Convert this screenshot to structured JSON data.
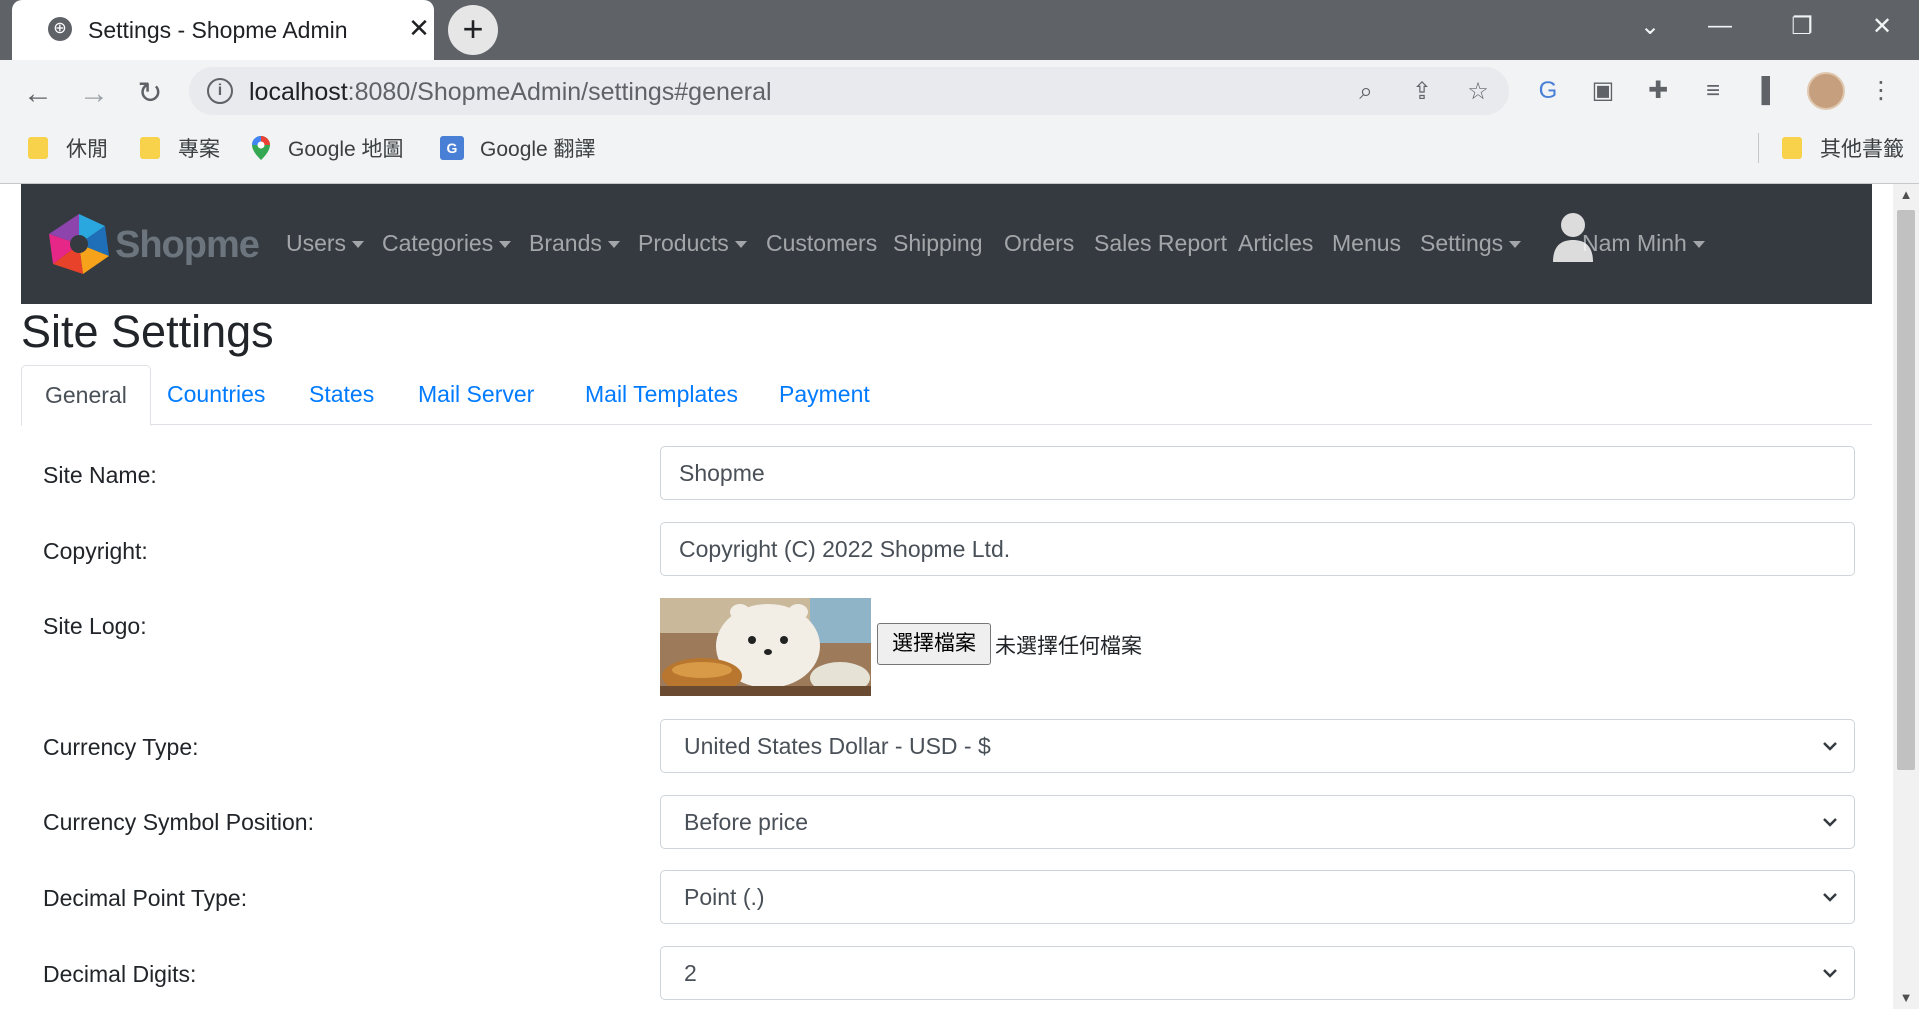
{
  "browser": {
    "tab_title": "Settings - Shopme Admin",
    "url_host": "localhost",
    "url_path": ":8080/ShopmeAdmin/settings#general",
    "bookmarks": [
      {
        "label": "休閒",
        "icon": "folder-icon"
      },
      {
        "label": "專案",
        "icon": "folder-icon"
      },
      {
        "label": "Google 地圖",
        "icon": "google-maps-icon"
      },
      {
        "label": "Google 翻譯",
        "icon": "google-translate-icon"
      }
    ],
    "other_bookmarks": "其他書籤"
  },
  "nav": {
    "brand": "Shopme",
    "items": [
      {
        "label": "Users",
        "dropdown": true
      },
      {
        "label": "Categories",
        "dropdown": true
      },
      {
        "label": "Brands",
        "dropdown": true
      },
      {
        "label": "Products",
        "dropdown": true
      },
      {
        "label": "Customers",
        "dropdown": false
      },
      {
        "label": "Shipping",
        "dropdown": false
      },
      {
        "label": "Orders",
        "dropdown": false
      },
      {
        "label": "Sales Report",
        "dropdown": false
      },
      {
        "label": "Articles",
        "dropdown": false
      },
      {
        "label": "Menus",
        "dropdown": false
      },
      {
        "label": "Settings",
        "dropdown": true
      }
    ],
    "user_name": "Nam Minh"
  },
  "page": {
    "title": "Site Settings",
    "tabs": [
      "General",
      "Countries",
      "States",
      "Mail Server",
      "Mail Templates",
      "Payment"
    ],
    "active_tab": "General"
  },
  "form": {
    "site_name_label": "Site Name:",
    "site_name_value": "Shopme",
    "copyright_label": "Copyright:",
    "copyright_value": "Copyright (C) 2022 Shopme Ltd.",
    "site_logo_label": "Site Logo:",
    "file_button": "選擇檔案",
    "file_status": "未選擇任何檔案",
    "currency_type_label": "Currency Type:",
    "currency_type_value": "United States Dollar - USD - $",
    "symbol_position_label": "Currency Symbol Position:",
    "symbol_position_value": "Before price",
    "decimal_point_label": "Decimal Point Type:",
    "decimal_point_value": "Point (.)",
    "decimal_digits_label": "Decimal Digits:",
    "decimal_digits_value": "2"
  },
  "colors": {
    "navbar": "#343a40",
    "link": "#007bff",
    "tabstrip": "#5f6368"
  }
}
